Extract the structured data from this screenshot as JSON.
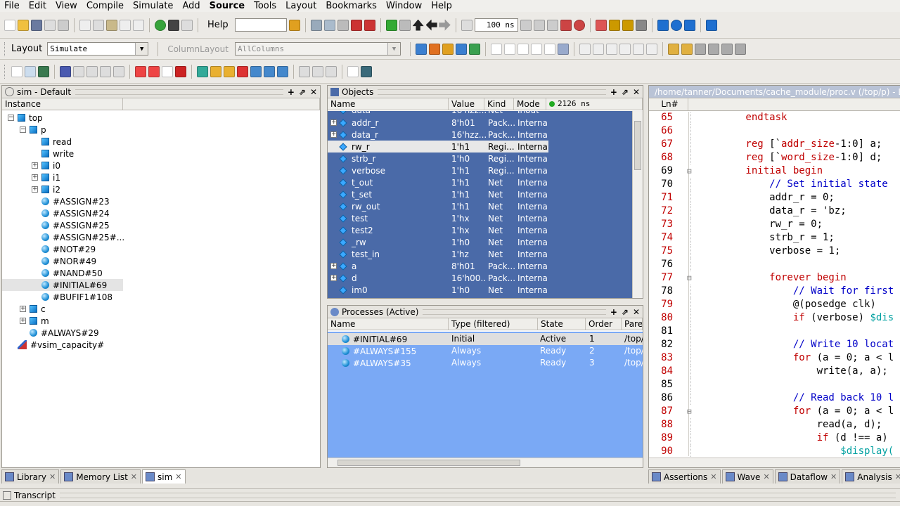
{
  "menu": [
    "File",
    "Edit",
    "View",
    "Compile",
    "Simulate",
    "Add",
    "Source",
    "Tools",
    "Layout",
    "Bookmarks",
    "Window",
    "Help"
  ],
  "toolbar": {
    "help_label": "Help",
    "help_value": "",
    "time_value": "100 ns",
    "layout_label": "Layout",
    "layout_value": "Simulate",
    "column_layout_label": "ColumnLayout",
    "column_layout_value": "AllColumns"
  },
  "sim_pane": {
    "title": "sim - Default",
    "column": "Instance",
    "items": [
      {
        "label": "top",
        "indent": 0,
        "expander": "-",
        "icon": "square"
      },
      {
        "label": "p",
        "indent": 1,
        "expander": "-",
        "icon": "square"
      },
      {
        "label": "read",
        "indent": 2,
        "expander": "",
        "icon": "square"
      },
      {
        "label": "write",
        "indent": 2,
        "expander": "",
        "icon": "square"
      },
      {
        "label": "i0",
        "indent": 2,
        "expander": "+",
        "icon": "square"
      },
      {
        "label": "i1",
        "indent": 2,
        "expander": "+",
        "icon": "square"
      },
      {
        "label": "i2",
        "indent": 2,
        "expander": "+",
        "icon": "square"
      },
      {
        "label": "#ASSIGN#23",
        "indent": 2,
        "expander": "",
        "icon": "ball"
      },
      {
        "label": "#ASSIGN#24",
        "indent": 2,
        "expander": "",
        "icon": "ball"
      },
      {
        "label": "#ASSIGN#25",
        "indent": 2,
        "expander": "",
        "icon": "ball"
      },
      {
        "label": "#ASSIGN#25#...",
        "indent": 2,
        "expander": "",
        "icon": "ball"
      },
      {
        "label": "#NOT#29",
        "indent": 2,
        "expander": "",
        "icon": "ball"
      },
      {
        "label": "#NOR#49",
        "indent": 2,
        "expander": "",
        "icon": "ball"
      },
      {
        "label": "#NAND#50",
        "indent": 2,
        "expander": "",
        "icon": "ball"
      },
      {
        "label": "#INITIAL#69",
        "indent": 2,
        "expander": "",
        "icon": "ball",
        "selected": true
      },
      {
        "label": "#BUFIF1#108",
        "indent": 2,
        "expander": "",
        "icon": "ball"
      },
      {
        "label": "c",
        "indent": 1,
        "expander": "+",
        "icon": "square"
      },
      {
        "label": "m",
        "indent": 1,
        "expander": "+",
        "icon": "square"
      },
      {
        "label": "#ALWAYS#29",
        "indent": 1,
        "expander": "",
        "icon": "ball"
      },
      {
        "label": "#vsim_capacity#",
        "indent": 0,
        "expander": "",
        "icon": "chart"
      }
    ]
  },
  "objects_pane": {
    "title": "Objects",
    "cols": [
      "Name",
      "Value",
      "Kind",
      "Mode"
    ],
    "now": "2126 ns",
    "rows": [
      {
        "name": "addr_r",
        "value": "8'h01",
        "kind": "Pack...",
        "mode": "Internal",
        "exp": true
      },
      {
        "name": "data_r",
        "value": "16'hzz...",
        "kind": "Pack...",
        "mode": "Internal",
        "exp": true
      },
      {
        "name": "rw_r",
        "value": "1'h1",
        "kind": "Regi...",
        "mode": "Internal",
        "sel": true
      },
      {
        "name": "strb_r",
        "value": "1'h0",
        "kind": "Regi...",
        "mode": "Internal"
      },
      {
        "name": "verbose",
        "value": "1'h1",
        "kind": "Regi...",
        "mode": "Internal"
      },
      {
        "name": "t_out",
        "value": "1'h1",
        "kind": "Net",
        "mode": "Internal"
      },
      {
        "name": "t_set",
        "value": "1'h1",
        "kind": "Net",
        "mode": "Internal"
      },
      {
        "name": "rw_out",
        "value": "1'h1",
        "kind": "Net",
        "mode": "Internal"
      },
      {
        "name": "test",
        "value": "1'hx",
        "kind": "Net",
        "mode": "Internal"
      },
      {
        "name": "test2",
        "value": "1'hx",
        "kind": "Net",
        "mode": "Internal"
      },
      {
        "name": "_rw",
        "value": "1'h0",
        "kind": "Net",
        "mode": "Internal"
      },
      {
        "name": "test_in",
        "value": "1'hz",
        "kind": "Net",
        "mode": "Internal"
      },
      {
        "name": "a",
        "value": "8'h01",
        "kind": "Pack...",
        "mode": "Internal",
        "exp": true
      },
      {
        "name": "d",
        "value": "16'h00...",
        "kind": "Pack...",
        "mode": "Internal",
        "exp": true
      },
      {
        "name": "im0",
        "value": "1'h0",
        "kind": "Net",
        "mode": "Internal"
      }
    ],
    "partial_row": {
      "name": "data",
      "value": "16'hzz...",
      "kind": "Net",
      "mode": "Inout"
    }
  },
  "processes_pane": {
    "title": "Processes (Active)",
    "cols": [
      "Name",
      "Type (filtered)",
      "State",
      "Order",
      "Pare"
    ],
    "rows": [
      {
        "name": "#INITIAL#69",
        "type": "Initial",
        "state": "Active",
        "order": "1",
        "parent": "/top/p",
        "sel": true
      },
      {
        "name": "#ALWAYS#155",
        "type": "Always",
        "state": "Ready",
        "order": "2",
        "parent": "/top/c"
      },
      {
        "name": "#ALWAYS#35",
        "type": "Always",
        "state": "Ready",
        "order": "3",
        "parent": "/top/m"
      }
    ]
  },
  "source_pane": {
    "title": "/home/tanner/Documents/cache_module/proc.v (/top/p) - Default",
    "ln_header": "Ln#",
    "lines": [
      {
        "n": "65",
        "parts": [
          [
            "kw",
            "        endtask"
          ]
        ]
      },
      {
        "n": "66",
        "parts": []
      },
      {
        "n": "67",
        "parts": [
          [
            "kw",
            "        reg "
          ],
          [
            "",
            "[`"
          ],
          [
            "kw",
            "addr_size"
          ],
          [
            "",
            "-1:0] a;"
          ]
        ]
      },
      {
        "n": "68",
        "parts": [
          [
            "kw",
            "        reg "
          ],
          [
            "",
            "[`"
          ],
          [
            "kw",
            "word_size"
          ],
          [
            "",
            "-1:0] d;"
          ]
        ]
      },
      {
        "n": "69",
        "parts": [
          [
            "kw",
            "        initial begin"
          ]
        ],
        "blk": true,
        "fold": true
      },
      {
        "n": "70",
        "parts": [
          [
            "cm",
            "            // Set initial state"
          ]
        ],
        "blk": true
      },
      {
        "n": "71",
        "parts": [
          [
            "",
            "            addr_r = 0;"
          ]
        ]
      },
      {
        "n": "72",
        "parts": [
          [
            "",
            "            data_r = 'bz;"
          ]
        ]
      },
      {
        "n": "73",
        "parts": [
          [
            "",
            "            rw_r = 0;"
          ]
        ]
      },
      {
        "n": "74",
        "parts": [
          [
            "",
            "            strb_r = 1;"
          ]
        ]
      },
      {
        "n": "75",
        "parts": [
          [
            "",
            "            verbose = 1;"
          ]
        ]
      },
      {
        "n": "76",
        "parts": [],
        "blk": true
      },
      {
        "n": "77",
        "parts": [
          [
            "kw",
            "            forever begin"
          ]
        ],
        "fold": true
      },
      {
        "n": "78",
        "parts": [
          [
            "cm",
            "                // Wait for first"
          ]
        ],
        "blk": true
      },
      {
        "n": "79",
        "parts": [
          [
            "",
            "                @(posedge clk)"
          ]
        ]
      },
      {
        "n": "80",
        "parts": [
          [
            "kw",
            "                if "
          ],
          [
            "",
            "(verbose) "
          ],
          [
            "sf",
            "$dis"
          ]
        ]
      },
      {
        "n": "81",
        "parts": [],
        "blk": true
      },
      {
        "n": "82",
        "parts": [
          [
            "cm",
            "                // Write 10 locat"
          ]
        ],
        "blk": true
      },
      {
        "n": "83",
        "parts": [
          [
            "kw",
            "                for "
          ],
          [
            "",
            "(a = 0; a < l"
          ]
        ]
      },
      {
        "n": "84",
        "parts": [
          [
            "",
            "                    write(a, a);"
          ]
        ]
      },
      {
        "n": "85",
        "parts": [],
        "blk": true
      },
      {
        "n": "86",
        "parts": [
          [
            "cm",
            "                // Read back 10 l"
          ]
        ],
        "blk": true
      },
      {
        "n": "87",
        "parts": [
          [
            "kw",
            "                for "
          ],
          [
            "",
            "(a = 0; a < l"
          ]
        ],
        "fold": true
      },
      {
        "n": "88",
        "parts": [
          [
            "",
            "                    read(a, d);"
          ]
        ]
      },
      {
        "n": "89",
        "parts": [
          [
            "kw",
            "                    if "
          ],
          [
            "",
            "(d !== a)"
          ]
        ]
      },
      {
        "n": "90",
        "parts": [
          [
            "sf",
            "                        $display("
          ]
        ]
      }
    ]
  },
  "bottom_tabs_left": [
    {
      "label": "Library",
      "icon": "library-icon"
    },
    {
      "label": "Memory List",
      "icon": "memory-icon"
    },
    {
      "label": "sim",
      "icon": "sim-icon",
      "active": true
    }
  ],
  "bottom_tabs_right": [
    {
      "label": "Assertions",
      "icon": "assertions-icon"
    },
    {
      "label": "Wave",
      "icon": "wave-icon"
    },
    {
      "label": "Dataflow",
      "icon": "dataflow-icon"
    },
    {
      "label": "Analysis",
      "icon": "analysis-icon"
    }
  ],
  "transcript": {
    "title": "Transcript"
  },
  "colors": {
    "object_bg": "#4a6aa8",
    "process_bg": "#7aa9f5",
    "keyword": "#c00000",
    "comment": "#0000c8",
    "sysfunc": "#00a0a0"
  }
}
